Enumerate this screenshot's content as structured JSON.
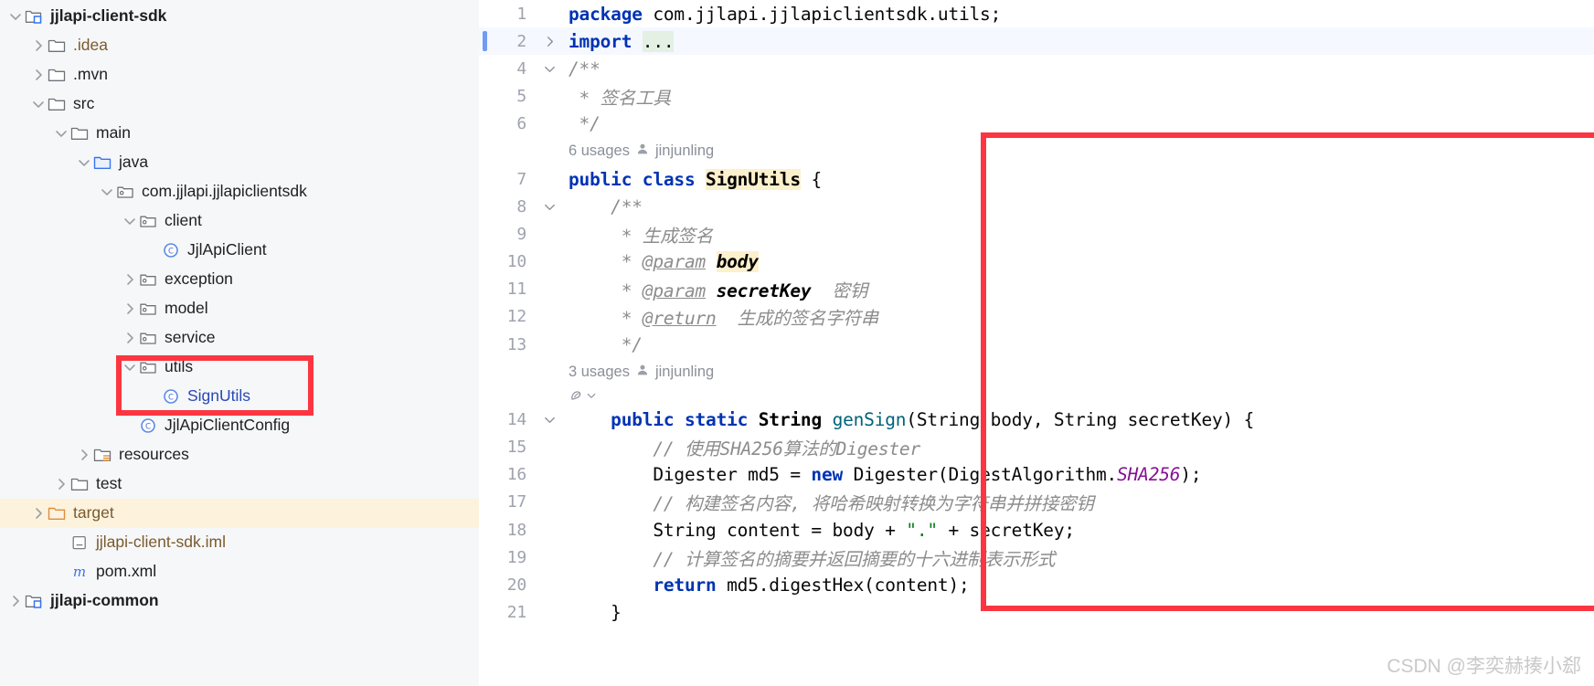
{
  "project_tree": {
    "name": "project-tool-window",
    "items": [
      {
        "label": "jjlapi-client-sdk",
        "indent": 0,
        "arrow": "down",
        "icon": "module-icon",
        "bold": true,
        "color": "#1e1f22",
        "highlight": false
      },
      {
        "label": ".idea",
        "indent": 1,
        "arrow": "right",
        "icon": "folder-icon",
        "bold": false,
        "color": "#7a5a2e",
        "highlight": false
      },
      {
        "label": ".mvn",
        "indent": 1,
        "arrow": "right",
        "icon": "folder-icon",
        "bold": false,
        "color": "#1e1f22",
        "highlight": false
      },
      {
        "label": "src",
        "indent": 1,
        "arrow": "down",
        "icon": "folder-icon",
        "bold": false,
        "color": "#1e1f22",
        "highlight": false
      },
      {
        "label": "main",
        "indent": 2,
        "arrow": "down",
        "icon": "folder-icon",
        "bold": false,
        "color": "#1e1f22",
        "highlight": false
      },
      {
        "label": "java",
        "indent": 3,
        "arrow": "down",
        "icon": "source-root-icon",
        "bold": false,
        "color": "#1e1f22",
        "highlight": false
      },
      {
        "label": "com.jjlapi.jjlapiclientsdk",
        "indent": 4,
        "arrow": "down",
        "icon": "package-icon",
        "bold": false,
        "color": "#1e1f22",
        "highlight": false
      },
      {
        "label": "client",
        "indent": 5,
        "arrow": "down",
        "icon": "package-icon",
        "bold": false,
        "color": "#1e1f22",
        "highlight": false
      },
      {
        "label": "JjlApiClient",
        "indent": 6,
        "arrow": "none",
        "icon": "java-class-icon",
        "bold": false,
        "color": "#1e1f22",
        "highlight": false
      },
      {
        "label": "exception",
        "indent": 5,
        "arrow": "right",
        "icon": "package-icon",
        "bold": false,
        "color": "#1e1f22",
        "highlight": false
      },
      {
        "label": "model",
        "indent": 5,
        "arrow": "right",
        "icon": "package-icon",
        "bold": false,
        "color": "#1e1f22",
        "highlight": false
      },
      {
        "label": "service",
        "indent": 5,
        "arrow": "right",
        "icon": "package-icon",
        "bold": false,
        "color": "#1e1f22",
        "highlight": false
      },
      {
        "label": "utils",
        "indent": 5,
        "arrow": "down",
        "icon": "package-icon",
        "bold": false,
        "color": "#1e1f22",
        "highlight": false
      },
      {
        "label": "SignUtils",
        "indent": 6,
        "arrow": "none",
        "icon": "java-class-icon",
        "bold": false,
        "color": "#2847b5",
        "highlight": false
      },
      {
        "label": "JjlApiClientConfig",
        "indent": 5,
        "arrow": "none",
        "icon": "java-class-icon",
        "bold": false,
        "color": "#1e1f22",
        "highlight": false
      },
      {
        "label": "resources",
        "indent": 3,
        "arrow": "right",
        "icon": "resource-root-icon",
        "bold": false,
        "color": "#1e1f22",
        "highlight": false
      },
      {
        "label": "test",
        "indent": 2,
        "arrow": "right",
        "icon": "folder-icon",
        "bold": false,
        "color": "#1e1f22",
        "highlight": false
      },
      {
        "label": "target",
        "indent": 1,
        "arrow": "right",
        "icon": "excluded-folder-icon",
        "bold": false,
        "color": "#7a5a2e",
        "highlight": true
      },
      {
        "label": "jjlapi-client-sdk.iml",
        "indent": 2,
        "arrow": "none",
        "icon": "iml-file-icon",
        "bold": false,
        "color": "#7a5a2e",
        "highlight": false
      },
      {
        "label": "pom.xml",
        "indent": 2,
        "arrow": "none",
        "icon": "maven-file-icon",
        "bold": false,
        "color": "#1e1f22",
        "highlight": false
      },
      {
        "label": "jjlapi-common",
        "indent": 0,
        "arrow": "right",
        "icon": "module-icon",
        "bold": true,
        "color": "#1e1f22",
        "highlight": false
      }
    ]
  },
  "editor": {
    "name": "code-editor",
    "lines": [
      {
        "no": "1",
        "fold": "none",
        "caret": false
      },
      {
        "no": "2",
        "fold": "right",
        "caret": true
      },
      {
        "no": "4",
        "fold": "down",
        "caret": false
      },
      {
        "no": "5",
        "fold": "none",
        "caret": false
      },
      {
        "no": "6",
        "fold": "none",
        "caret": false
      },
      {
        "no": "7",
        "fold": "none",
        "caret": false
      },
      {
        "no": "8",
        "fold": "down",
        "caret": false
      },
      {
        "no": "9",
        "fold": "none",
        "caret": false
      },
      {
        "no": "10",
        "fold": "none",
        "caret": false
      },
      {
        "no": "11",
        "fold": "none",
        "caret": false
      },
      {
        "no": "12",
        "fold": "none",
        "caret": false
      },
      {
        "no": "13",
        "fold": "none",
        "caret": false
      },
      {
        "no": "14",
        "fold": "down",
        "caret": false
      },
      {
        "no": "15",
        "fold": "none",
        "caret": false
      },
      {
        "no": "16",
        "fold": "none",
        "caret": false
      },
      {
        "no": "17",
        "fold": "none",
        "caret": false
      },
      {
        "no": "18",
        "fold": "none",
        "caret": false
      },
      {
        "no": "19",
        "fold": "none",
        "caret": false
      },
      {
        "no": "20",
        "fold": "none",
        "caret": false
      },
      {
        "no": "21",
        "fold": "none",
        "caret": false
      }
    ],
    "code": {
      "l1_package_kw": "package",
      "l1_package_name": " com.jjlapi.jjlapiclientsdk.utils;",
      "l2_import_kw": "import",
      "l2_import_dots": "...",
      "l4_doc_open": "/**",
      "l5_doc_star": " * ",
      "l5_doc_text": "签名工具",
      "l6_doc_close": " */",
      "l7_public": "public",
      "l7_class": "class",
      "l7_name": "SignUtils",
      "l7_brace": " {",
      "l8_doc_open": "    /**",
      "l9_star": "     * ",
      "l9_text": "生成签名",
      "l10_star": "     * ",
      "l10_tag": "@param",
      "l10_param": "body",
      "l11_star": "     * ",
      "l11_tag": "@param",
      "l11_param": "secretKey",
      "l11_desc": "密钥",
      "l12_star": "     * ",
      "l12_tag": "@return",
      "l12_desc": "生成的签名字符串",
      "l13_doc_close": "     */",
      "l14_public": "public",
      "l14_static": "static",
      "l14_String": "String",
      "l14_method": "genSign",
      "l14_args": "(String body, String secretKey) {",
      "l15_comment": "// 使用SHA256算法的Digester",
      "l16_a": "        Digester md5 = ",
      "l16_new": "new",
      "l16_b": " Digester(DigestAlgorithm.",
      "l16_const": "SHA256",
      "l16_c": ");",
      "l17_comment": "// 构建签名内容, 将哈希映射转换为字符串并拼接密钥",
      "l18_a": "        String content = body + ",
      "l18_str": "\".\"",
      "l18_b": " + secretKey;",
      "l19_comment": "// 计算签名的摘要并返回摘要的十六进制表示形式",
      "l20_return": "return",
      "l20_rest": " md5.digestHex(content);",
      "l21_brace": "    }"
    },
    "inlay_hints": [
      {
        "name": "class-usages-hint",
        "usages": "6 usages",
        "author": "jinjunling"
      },
      {
        "name": "method-usages-hint",
        "usages": "3 usages",
        "author": "jinjunling"
      }
    ]
  },
  "annotations": {
    "tree_box_color": "#fb3640",
    "code_box_color": "#fb3640"
  },
  "watermark": {
    "text": "CSDN @李奕赫揍小郄"
  }
}
